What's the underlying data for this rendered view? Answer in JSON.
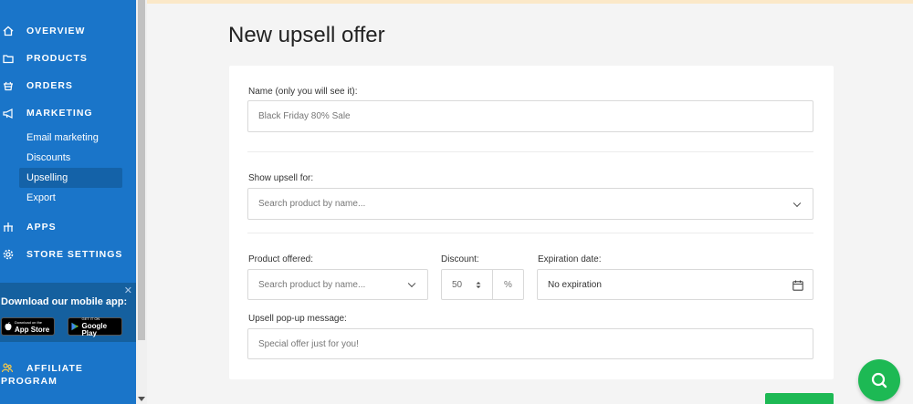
{
  "sidebar": {
    "nav": [
      {
        "label": "OVERVIEW",
        "icon": "home-icon"
      },
      {
        "label": "PRODUCTS",
        "icon": "folder-icon"
      },
      {
        "label": "ORDERS",
        "icon": "basket-icon"
      },
      {
        "label": "MARKETING",
        "icon": "megaphone-icon"
      },
      {
        "label": "APPS",
        "icon": "apps-icon"
      },
      {
        "label": "STORE SETTINGS",
        "icon": "gear-icon"
      }
    ],
    "marketing_sub": [
      "Email marketing",
      "Discounts",
      "Upselling",
      "Export"
    ],
    "active_sub": "Upselling",
    "mobile_app": {
      "title": "Download our mobile app:",
      "close": "✕",
      "app_store_small": "Download on the",
      "app_store": "App Store",
      "google_play_small": "GET IT ON",
      "google_play": "Google Play"
    },
    "affiliate": {
      "line1": "AFFILIATE",
      "line2": "PROGRAM"
    }
  },
  "page": {
    "title": "New upsell offer"
  },
  "form": {
    "name_label": "Name (only you will see it):",
    "name_placeholder": "Black Friday 80% Sale",
    "show_for_label": "Show upsell for:",
    "show_for_placeholder": "Search product by name...",
    "product_offered_label": "Product offered:",
    "product_offered_placeholder": "Search product by name...",
    "discount_label": "Discount:",
    "discount_value": "50",
    "discount_unit": "%",
    "expiration_label": "Expiration date:",
    "expiration_value": "No expiration",
    "message_label": "Upsell pop-up message:",
    "message_placeholder": "Special offer just for you!"
  },
  "colors": {
    "sidebar": "#1a75c9",
    "accent": "#1db954"
  }
}
